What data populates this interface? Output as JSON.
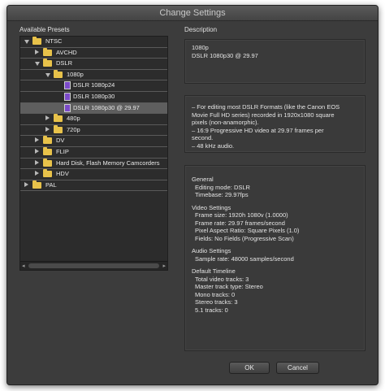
{
  "window": {
    "title": "Change Settings"
  },
  "left": {
    "label": "Available Presets",
    "tree": [
      {
        "label": "NTSC",
        "level": 0,
        "kind": "folder",
        "open": true
      },
      {
        "label": "AVCHD",
        "level": 1,
        "kind": "folder",
        "open": false
      },
      {
        "label": "DSLR",
        "level": 1,
        "kind": "folder",
        "open": true
      },
      {
        "label": "1080p",
        "level": 2,
        "kind": "folder",
        "open": true
      },
      {
        "label": "DSLR 1080p24",
        "level": 3,
        "kind": "preset"
      },
      {
        "label": "DSLR 1080p30",
        "level": 3,
        "kind": "preset"
      },
      {
        "label": "DSLR 1080p30 @ 29.97",
        "level": 3,
        "kind": "preset",
        "selected": true
      },
      {
        "label": "480p",
        "level": 2,
        "kind": "folder",
        "open": false
      },
      {
        "label": "720p",
        "level": 2,
        "kind": "folder",
        "open": false
      },
      {
        "label": "DV",
        "level": 1,
        "kind": "folder",
        "open": false
      },
      {
        "label": "FLIP",
        "level": 1,
        "kind": "folder",
        "open": false
      },
      {
        "label": "Hard Disk, Flash Memory Camcorders",
        "level": 1,
        "kind": "folder",
        "open": false
      },
      {
        "label": "HDV",
        "level": 1,
        "kind": "folder",
        "open": false
      },
      {
        "label": "PAL",
        "level": 0,
        "kind": "folder",
        "open": false
      }
    ],
    "scroll_left": "◂",
    "scroll_right": "▸"
  },
  "right": {
    "label": "Description",
    "summary": [
      "1080p",
      "DSLR 1080p30 @ 29.97"
    ],
    "description": [
      "– For editing most DSLR Formats (like the Canon EOS",
      "Movie Full HD series) recorded in 1920x1080 square",
      "pixels (non-anamorphic).",
      "– 16:9 Progressive HD video at 29.97 frames per",
      "second.",
      "– 48 kHz audio."
    ],
    "details": [
      {
        "heading": "General",
        "lines": [
          "Editing mode: DSLR",
          "Timebase: 29.97fps"
        ]
      },
      {
        "heading": "Video Settings",
        "lines": [
          "Frame size: 1920h 1080v (1.0000)",
          "Frame rate: 29.97 frames/second",
          "Pixel Aspect Ratio: Square Pixels (1.0)",
          "Fields: No Fields (Progressive Scan)"
        ]
      },
      {
        "heading": "Audio Settings",
        "lines": [
          "Sample rate: 48000 samples/second"
        ]
      },
      {
        "heading": "Default Timeline",
        "lines": [
          "Total video tracks: 3",
          "Master track type: Stereo",
          "Mono tracks: 0",
          "Stereo tracks: 3",
          "5.1 tracks: 0"
        ]
      }
    ]
  },
  "buttons": {
    "ok": "OK",
    "cancel": "Cancel"
  },
  "colors": {
    "window_bg": "#3c3c3c",
    "folder": "#e8c24a",
    "preset_icon": "#7b4ac9",
    "selected_row": "#5e5e5e"
  }
}
